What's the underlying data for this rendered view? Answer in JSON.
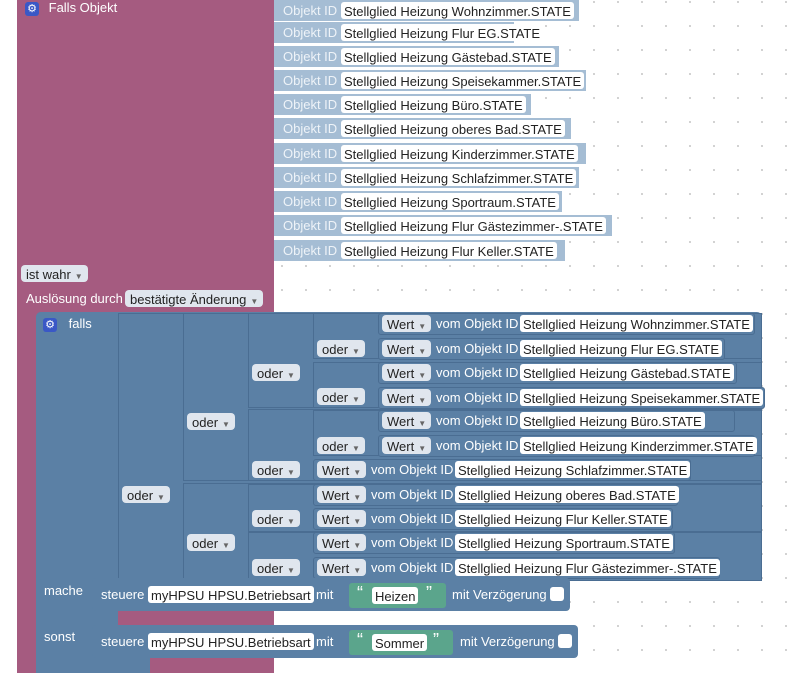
{
  "trigger": {
    "title": "Falls Objekt",
    "object_label": "Objekt ID",
    "objects": [
      "Stellglied Heizung Wohnzimmer.STATE",
      "Stellglied Heizung Flur EG.STATE",
      "Stellglied Heizung Gästebad.STATE",
      "Stellglied Heizung Speisekammer.STATE",
      "Stellglied Heizung Büro.STATE",
      "Stellglied Heizung oberes Bad.STATE",
      "Stellglied Heizung Kinderzimmer.STATE",
      "Stellglied Heizung Schlafzimmer.STATE",
      "Stellglied Heizung Sportraum.STATE",
      "Stellglied Heizung Flur Gästezimmer-.STATE",
      "Stellglied Heizung Flur Keller.STATE"
    ],
    "condition_value": "ist wahr",
    "trigger_label": "Auslösung durch",
    "trigger_value": "bestätigte Änderung"
  },
  "if_block": {
    "falls_label": "falls",
    "oder_label": "oder",
    "wert_label": "Wert",
    "vom_objekt_label": "vom Objekt ID",
    "conditions": [
      "Stellglied Heizung Wohnzimmer.STATE",
      "Stellglied Heizung Flur EG.STATE",
      "Stellglied Heizung Gästebad.STATE",
      "Stellglied Heizung Speisekammer.STATE",
      "Stellglied Heizung Büro.STATE",
      "Stellglied Heizung Kinderzimmer.STATE",
      "Stellglied Heizung Schlafzimmer.STATE",
      "Stellglied Heizung oberes Bad.STATE",
      "Stellglied Heizung Flur Keller.STATE",
      "Stellglied Heizung Sportraum.STATE",
      "Stellglied Heizung Flur Gästezimmer-.STATE"
    ],
    "mache_label": "mache",
    "sonst_label": "sonst",
    "steuere_label": "steuere",
    "target": "myHPSU HPSU.Betriebsart",
    "mit_label": "mit",
    "then_value": "Heizen",
    "else_value": "Sommer",
    "delay_label": "mit Verzögerung"
  },
  "colors": {
    "event_block": "#a55b80",
    "logic_block": "#5b80a5",
    "object_item": "#a5bdd4",
    "text_block": "#5ba58c"
  },
  "icons": {
    "gear": "gear-icon",
    "dropdown": "triangle-down-icon"
  }
}
